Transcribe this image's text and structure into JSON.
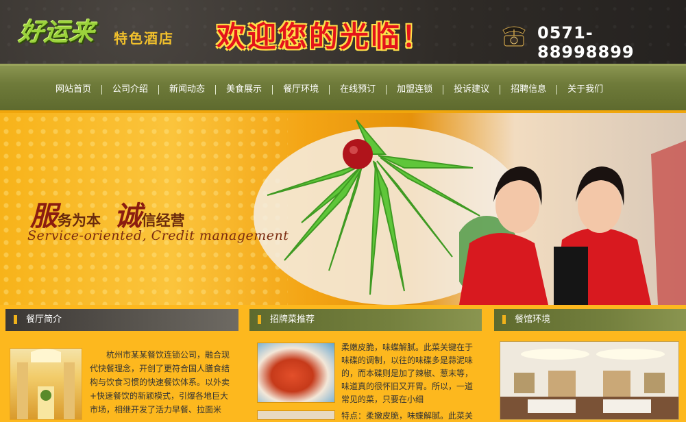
{
  "header": {
    "logo_main": "好运来",
    "logo_sub": "特色酒店",
    "welcome": "欢迎您的光临！",
    "phone": "0571-88998899"
  },
  "nav": {
    "items": [
      "网站首页",
      "公司介绍",
      "新闻动态",
      "美食展示",
      "餐厅环境",
      "在线预订",
      "加盟连锁",
      "投诉建议",
      "招聘信息",
      "关于我们"
    ]
  },
  "banner": {
    "slogan_char1": "服",
    "slogan_part1": "务为本",
    "slogan_char2": "诚",
    "slogan_part2": "信经营",
    "slogan_en": "Service-oriented, Credit management"
  },
  "sections": {
    "intro": {
      "title": "餐厅简介",
      "text": "杭州市某某餐饮连锁公司，融合现代快餐理念，开创了更符合国人膳食结构与饮食习惯的快速餐饮体系。以外卖+快速餐饮的新颖模式，引爆各地巨大市场，相继开发了活力早餐、拉面米"
    },
    "dishes": {
      "title": "招牌菜推荐",
      "text1": "柔嫩皮脆，味蝶解腻。此菜关键在于味碟的调制，以往的味碟多是蒜泥味的，而本碟则是加了辣椒、葱末等，味道真的很怀旧又开胃。所以，一道常见的菜，只要在小细",
      "text2": "特点：柔嫩皮脆，味蝶解腻。此菜关"
    },
    "environment": {
      "title": "餐馆环境"
    }
  },
  "colors": {
    "page_bg": "#fdb81e",
    "nav_bg": "#6f7b3a",
    "welcome_red": "#e3141b"
  }
}
